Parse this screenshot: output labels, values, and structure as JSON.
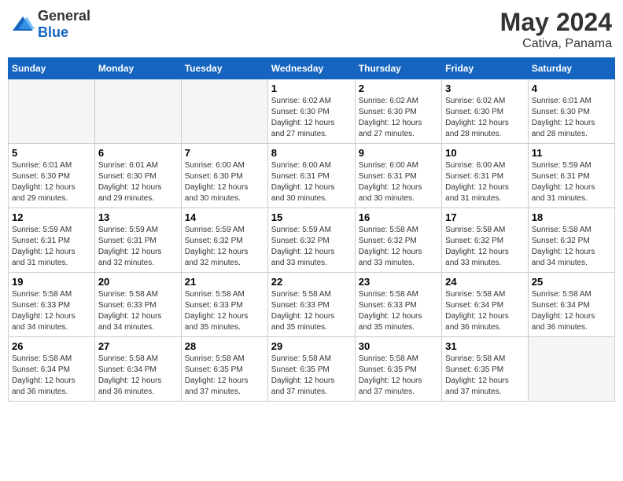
{
  "header": {
    "logo_general": "General",
    "logo_blue": "Blue",
    "month": "May 2024",
    "location": "Cativa, Panama"
  },
  "weekdays": [
    "Sunday",
    "Monday",
    "Tuesday",
    "Wednesday",
    "Thursday",
    "Friday",
    "Saturday"
  ],
  "weeks": [
    [
      {
        "day": "",
        "info": ""
      },
      {
        "day": "",
        "info": ""
      },
      {
        "day": "",
        "info": ""
      },
      {
        "day": "1",
        "info": "Sunrise: 6:02 AM\nSunset: 6:30 PM\nDaylight: 12 hours\nand 27 minutes."
      },
      {
        "day": "2",
        "info": "Sunrise: 6:02 AM\nSunset: 6:30 PM\nDaylight: 12 hours\nand 27 minutes."
      },
      {
        "day": "3",
        "info": "Sunrise: 6:02 AM\nSunset: 6:30 PM\nDaylight: 12 hours\nand 28 minutes."
      },
      {
        "day": "4",
        "info": "Sunrise: 6:01 AM\nSunset: 6:30 PM\nDaylight: 12 hours\nand 28 minutes."
      }
    ],
    [
      {
        "day": "5",
        "info": "Sunrise: 6:01 AM\nSunset: 6:30 PM\nDaylight: 12 hours\nand 29 minutes."
      },
      {
        "day": "6",
        "info": "Sunrise: 6:01 AM\nSunset: 6:30 PM\nDaylight: 12 hours\nand 29 minutes."
      },
      {
        "day": "7",
        "info": "Sunrise: 6:00 AM\nSunset: 6:30 PM\nDaylight: 12 hours\nand 30 minutes."
      },
      {
        "day": "8",
        "info": "Sunrise: 6:00 AM\nSunset: 6:31 PM\nDaylight: 12 hours\nand 30 minutes."
      },
      {
        "day": "9",
        "info": "Sunrise: 6:00 AM\nSunset: 6:31 PM\nDaylight: 12 hours\nand 30 minutes."
      },
      {
        "day": "10",
        "info": "Sunrise: 6:00 AM\nSunset: 6:31 PM\nDaylight: 12 hours\nand 31 minutes."
      },
      {
        "day": "11",
        "info": "Sunrise: 5:59 AM\nSunset: 6:31 PM\nDaylight: 12 hours\nand 31 minutes."
      }
    ],
    [
      {
        "day": "12",
        "info": "Sunrise: 5:59 AM\nSunset: 6:31 PM\nDaylight: 12 hours\nand 31 minutes."
      },
      {
        "day": "13",
        "info": "Sunrise: 5:59 AM\nSunset: 6:31 PM\nDaylight: 12 hours\nand 32 minutes."
      },
      {
        "day": "14",
        "info": "Sunrise: 5:59 AM\nSunset: 6:32 PM\nDaylight: 12 hours\nand 32 minutes."
      },
      {
        "day": "15",
        "info": "Sunrise: 5:59 AM\nSunset: 6:32 PM\nDaylight: 12 hours\nand 33 minutes."
      },
      {
        "day": "16",
        "info": "Sunrise: 5:58 AM\nSunset: 6:32 PM\nDaylight: 12 hours\nand 33 minutes."
      },
      {
        "day": "17",
        "info": "Sunrise: 5:58 AM\nSunset: 6:32 PM\nDaylight: 12 hours\nand 33 minutes."
      },
      {
        "day": "18",
        "info": "Sunrise: 5:58 AM\nSunset: 6:32 PM\nDaylight: 12 hours\nand 34 minutes."
      }
    ],
    [
      {
        "day": "19",
        "info": "Sunrise: 5:58 AM\nSunset: 6:33 PM\nDaylight: 12 hours\nand 34 minutes."
      },
      {
        "day": "20",
        "info": "Sunrise: 5:58 AM\nSunset: 6:33 PM\nDaylight: 12 hours\nand 34 minutes."
      },
      {
        "day": "21",
        "info": "Sunrise: 5:58 AM\nSunset: 6:33 PM\nDaylight: 12 hours\nand 35 minutes."
      },
      {
        "day": "22",
        "info": "Sunrise: 5:58 AM\nSunset: 6:33 PM\nDaylight: 12 hours\nand 35 minutes."
      },
      {
        "day": "23",
        "info": "Sunrise: 5:58 AM\nSunset: 6:33 PM\nDaylight: 12 hours\nand 35 minutes."
      },
      {
        "day": "24",
        "info": "Sunrise: 5:58 AM\nSunset: 6:34 PM\nDaylight: 12 hours\nand 36 minutes."
      },
      {
        "day": "25",
        "info": "Sunrise: 5:58 AM\nSunset: 6:34 PM\nDaylight: 12 hours\nand 36 minutes."
      }
    ],
    [
      {
        "day": "26",
        "info": "Sunrise: 5:58 AM\nSunset: 6:34 PM\nDaylight: 12 hours\nand 36 minutes."
      },
      {
        "day": "27",
        "info": "Sunrise: 5:58 AM\nSunset: 6:34 PM\nDaylight: 12 hours\nand 36 minutes."
      },
      {
        "day": "28",
        "info": "Sunrise: 5:58 AM\nSunset: 6:35 PM\nDaylight: 12 hours\nand 37 minutes."
      },
      {
        "day": "29",
        "info": "Sunrise: 5:58 AM\nSunset: 6:35 PM\nDaylight: 12 hours\nand 37 minutes."
      },
      {
        "day": "30",
        "info": "Sunrise: 5:58 AM\nSunset: 6:35 PM\nDaylight: 12 hours\nand 37 minutes."
      },
      {
        "day": "31",
        "info": "Sunrise: 5:58 AM\nSunset: 6:35 PM\nDaylight: 12 hours\nand 37 minutes."
      },
      {
        "day": "",
        "info": ""
      }
    ]
  ]
}
